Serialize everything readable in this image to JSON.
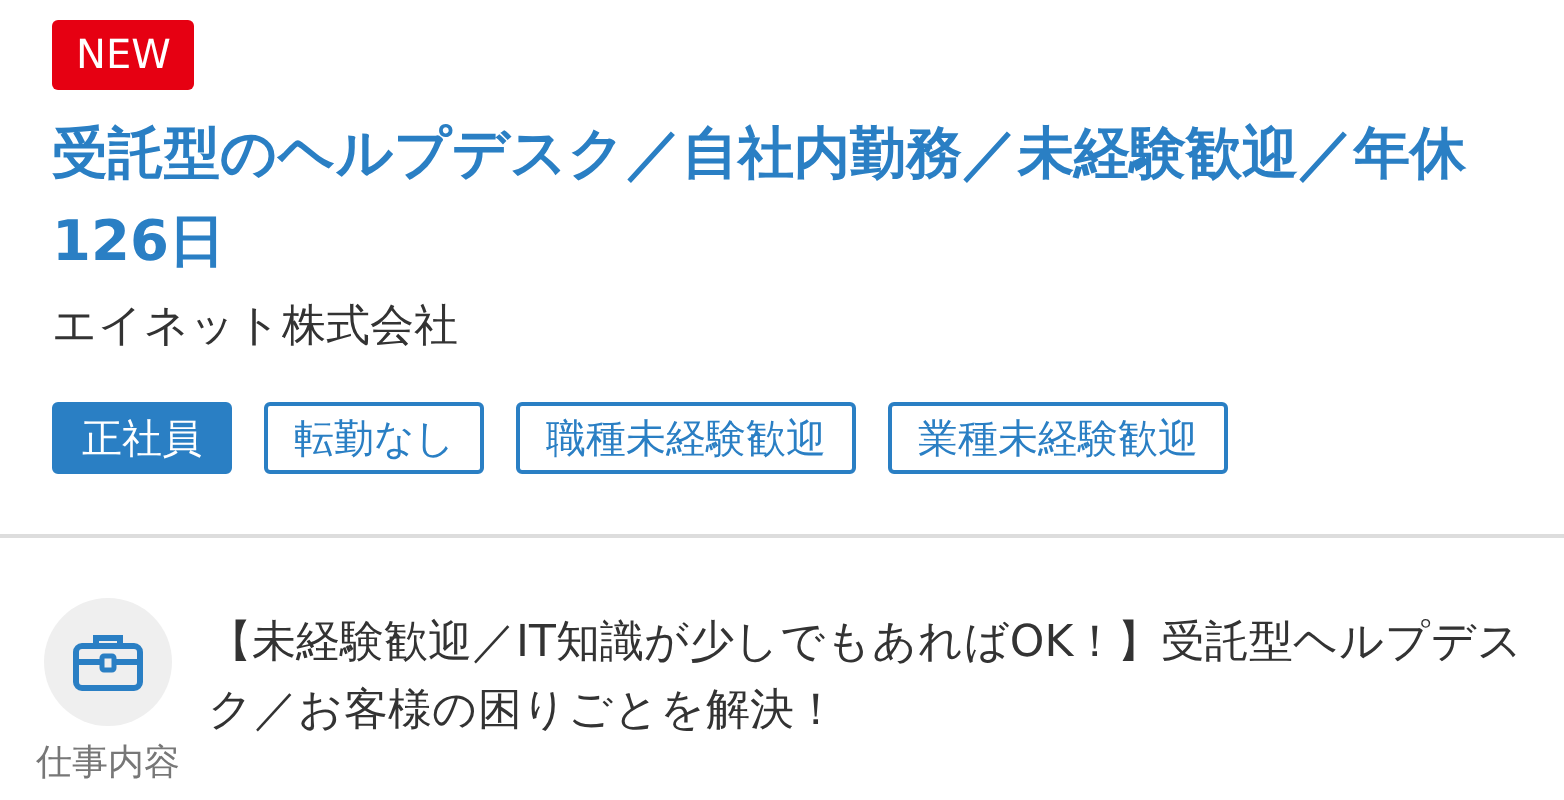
{
  "badge": "NEW",
  "title": "受託型のヘルプデスク／自社内勤務／未経験歓迎／年休126日",
  "company": "エイネット株式会社",
  "tags": [
    {
      "label": "正社員",
      "kind": "filled"
    },
    {
      "label": "転勤なし",
      "kind": "outline"
    },
    {
      "label": "職種未経験歓迎",
      "kind": "outline"
    },
    {
      "label": "業種未経験歓迎",
      "kind": "outline"
    }
  ],
  "section": {
    "label": "仕事内容",
    "text": "【未経験歓迎／IT知識が少しでもあればOK！】受託型ヘルプデスク／お客様の困りごとを解決！"
  }
}
